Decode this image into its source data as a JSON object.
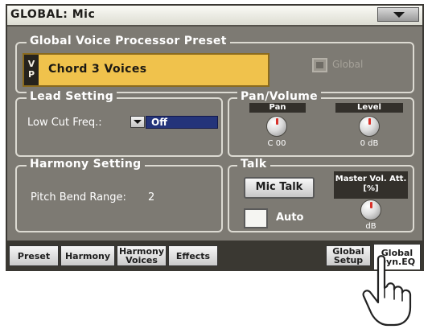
{
  "title": "GLOBAL: Mic",
  "voice_processor": {
    "section_title": "Global Voice Processor Preset",
    "vp_tag": "VP",
    "preset_name": "Chord 3 Voices",
    "global_label": "Global"
  },
  "lead": {
    "section_title": "Lead Setting",
    "low_cut_label": "Low Cut Freq.:",
    "low_cut_value": "Off"
  },
  "pan_volume": {
    "section_title": "Pan/Volume",
    "pan_label": "Pan",
    "pan_value": "C 00",
    "level_label": "Level",
    "level_value": "0 dB"
  },
  "harmony": {
    "section_title": "Harmony Setting",
    "pitch_bend_label": "Pitch Bend Range:",
    "pitch_bend_value": "2"
  },
  "talk": {
    "section_title": "Talk",
    "mic_talk_label": "Mic Talk",
    "auto_label": "Auto",
    "master_vol_label": "Master Vol. Att.[%]",
    "master_vol_value": "dB"
  },
  "tabs": [
    {
      "label": "Preset"
    },
    {
      "label": "Harmony"
    },
    {
      "label": "Harmony Voices"
    },
    {
      "label": "Effects"
    },
    {
      "label": "Global Setup"
    },
    {
      "label": "Global Dyn.EQ"
    }
  ],
  "selected_tab": "Global Dyn.EQ",
  "colors": {
    "screen_bg": "#7d7a73",
    "preset_highlight": "#f0c24c",
    "dropdown_field": "#24347a",
    "knob_marker": "#d8322b"
  }
}
